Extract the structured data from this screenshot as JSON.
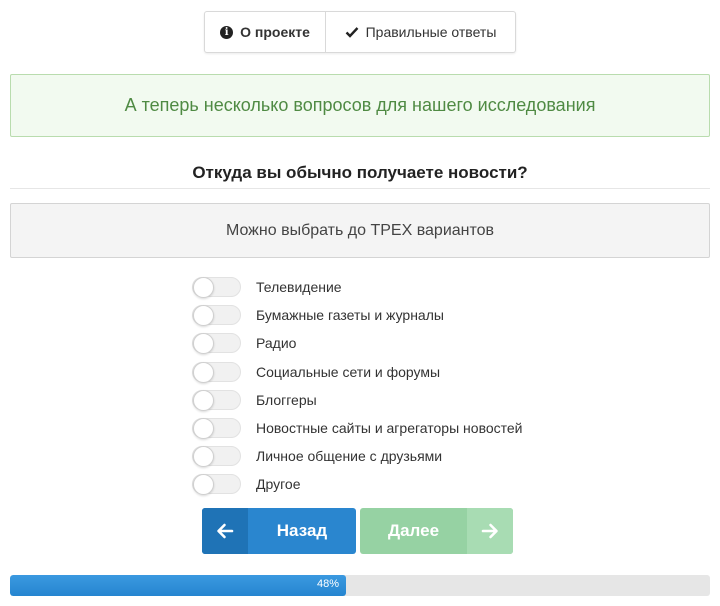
{
  "top_buttons": {
    "about_label": "О проекте",
    "answers_label": "Правильные ответы"
  },
  "intro": "А теперь несколько вопросов для нашего исследования",
  "question": "Откуда вы обычно получаете новости?",
  "hint": "Можно выбрать до ТРЕХ вариантов",
  "options": [
    {
      "label": "Телевидение",
      "checked": false
    },
    {
      "label": "Бумажные газеты и журналы",
      "checked": false
    },
    {
      "label": "Радио",
      "checked": false
    },
    {
      "label": "Социальные сети и форумы",
      "checked": false
    },
    {
      "label": "Блоггеры",
      "checked": false
    },
    {
      "label": "Новостные сайты и агрегаторы новостей",
      "checked": false
    },
    {
      "label": "Личное общение с друзьями",
      "checked": false
    },
    {
      "label": "Другое",
      "checked": false
    }
  ],
  "nav": {
    "back_label": "Назад",
    "next_label": "Далее"
  },
  "progress": {
    "percent": 48,
    "text": "48%"
  },
  "colors": {
    "primary": "#2a86cf",
    "next_disabled": "#96d2a3",
    "intro_text": "#4f8a43"
  }
}
